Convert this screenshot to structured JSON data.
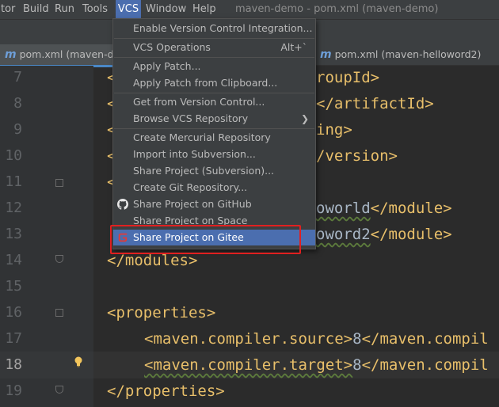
{
  "menubar": {
    "items": [
      "tor",
      "Build",
      "Run",
      "Tools",
      "VCS",
      "Window",
      "Help"
    ],
    "active": "VCS",
    "window_title": "maven-demo - pom.xml (maven-demo)"
  },
  "tabs": [
    {
      "icon": "m",
      "label": "pom.xml (maven-de"
    },
    {
      "icon": "m",
      "label": "pom.xml (maven-helloword2)"
    }
  ],
  "line_numbers": [
    "7",
    "8",
    "9",
    "10",
    "11",
    "12",
    "13",
    "14",
    "15",
    "16",
    "17",
    "18",
    "19"
  ],
  "current_line": "18",
  "code": {
    "l7": "roupId>",
    "l8": "</artifactId>",
    "l9": "ing>",
    "l10": "/version>",
    "l12_text": "oworld",
    "l12_tag": "</module>",
    "l13_text": "oword2",
    "l13_tag": "</module>",
    "l14": "</modules>",
    "l16": "<properties>",
    "l17_open": "<maven.compiler.source>",
    "l17_val": "8",
    "l17_close": "</maven.compil",
    "l18_open": "<maven.compiler.target>",
    "l18_val": "8",
    "l18_close": "</maven.compil",
    "l19": "</properties>"
  },
  "vcs_menu": {
    "items": [
      {
        "label": "Enable Version Control Integration...",
        "shortcut": ""
      },
      {
        "label": "VCS Operations",
        "shortcut": "Alt+`"
      },
      {
        "label": "Apply Patch...",
        "shortcut": ""
      },
      {
        "label": "Apply Patch from Clipboard...",
        "shortcut": ""
      },
      {
        "label": "Get from Version Control...",
        "shortcut": ""
      },
      {
        "label": "Browse VCS Repository",
        "shortcut": ""
      },
      {
        "label": "Create Mercurial Repository",
        "shortcut": ""
      },
      {
        "label": "Import into Subversion...",
        "shortcut": ""
      },
      {
        "label": "Share Project (Subversion)...",
        "shortcut": ""
      },
      {
        "label": "Create Git Repository...",
        "shortcut": ""
      },
      {
        "label": "Share Project on GitHub",
        "shortcut": "",
        "icon": "github-icon"
      },
      {
        "label": "Share Project on Space",
        "shortcut": ""
      },
      {
        "label": "Share Project on Gitee",
        "shortcut": "",
        "icon": "gitee-icon"
      }
    ]
  },
  "colors": {
    "menu_selection": "#4b6eaf",
    "highlight_box": "#e02020",
    "xml_tag": "#e8bf6a",
    "text": "#a9b7c6"
  }
}
